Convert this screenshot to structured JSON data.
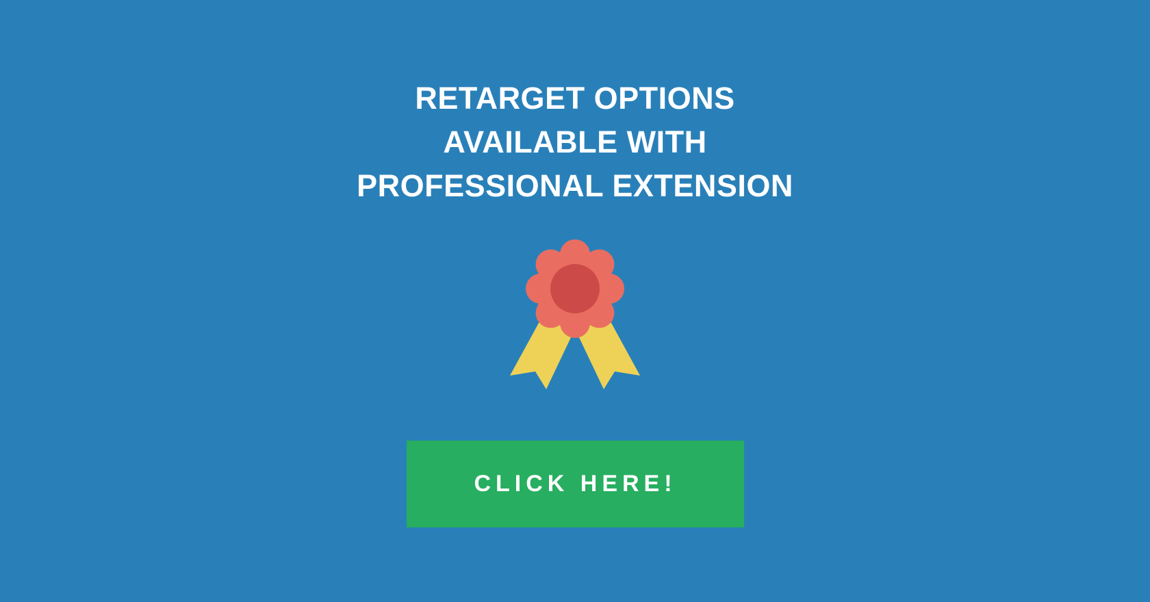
{
  "promo": {
    "headline_lines": [
      "RETARGET OPTIONS",
      "AVAILABLE WITH",
      "PROFESSIONAL EXTENSION"
    ],
    "badge_icon": "award-ribbon-icon",
    "cta_label": "CLICK HERE!"
  },
  "colors": {
    "background": "#2980b9",
    "cta_background": "#27ae60",
    "text": "#ffffff",
    "badge_outer": "#e96e61",
    "badge_inner": "#cc4a47",
    "ribbon": "#eed257"
  }
}
